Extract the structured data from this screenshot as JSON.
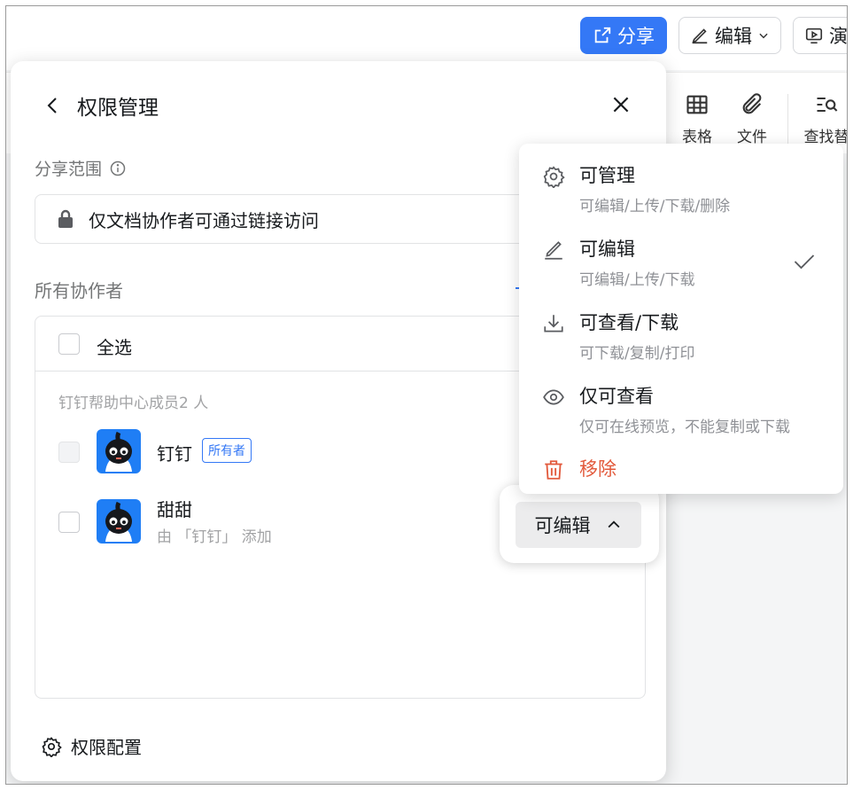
{
  "topbar": {
    "share_label": "分享",
    "edit_label": "编辑",
    "present_label": "演"
  },
  "toolbar": {
    "table_label": "表格",
    "file_label": "文件",
    "find_label": "查找替"
  },
  "panel": {
    "title": "权限管理",
    "scope_label": "分享范围",
    "scope_value": "仅文档协作者可通过链接访问",
    "collaborators_title": "所有协作者",
    "select_all_label": "全选",
    "group_label": "钉钉帮助中心成员2 人",
    "members": [
      {
        "name": "钉钉",
        "badge": "所有者",
        "sub": ""
      },
      {
        "name": "甜甜",
        "badge": "",
        "sub": "由 「钉钉」 添加"
      }
    ],
    "config_label": "权限配置"
  },
  "permission_trigger": {
    "label": "可编辑"
  },
  "permission_menu": {
    "items": [
      {
        "icon": "gear-icon",
        "label": "可管理",
        "desc": "可编辑/上传/下载/删除",
        "selected": false
      },
      {
        "icon": "pencil-icon",
        "label": "可编辑",
        "desc": "可编辑/上传/下载",
        "selected": true
      },
      {
        "icon": "download-icon",
        "label": "可查看/下载",
        "desc": "可下载/复制/打印",
        "selected": false
      },
      {
        "icon": "eye-icon",
        "label": "仅可查看",
        "desc": "仅可在线预览，不能复制或下载",
        "selected": false
      },
      {
        "icon": "trash-icon",
        "label": "移除",
        "desc": "",
        "selected": false
      }
    ]
  },
  "colors": {
    "accent": "#3478f6",
    "danger": "#e2593b"
  }
}
